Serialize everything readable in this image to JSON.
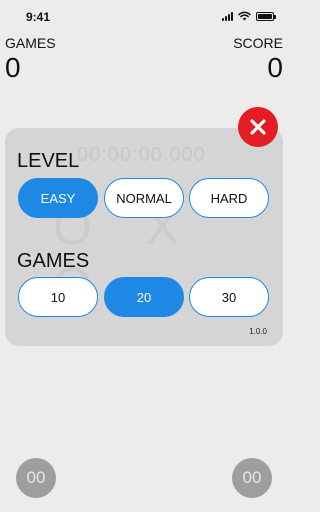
{
  "status": {
    "time": "9:41"
  },
  "header": {
    "games_label": "GAMES",
    "games_value": "0",
    "score_label": "SCORE",
    "score_value": "0"
  },
  "settings": {
    "timer_text": "00:00:00.000",
    "board_ghost": "O X O",
    "level_label": "LEVEL",
    "levels": [
      "EASY",
      "NORMAL",
      "HARD"
    ],
    "selected_level": "EASY",
    "games_label": "GAMES",
    "game_counts": [
      "10",
      "20",
      "30"
    ],
    "selected_games": "20",
    "version": "1.0.0"
  },
  "footer": {
    "left_button": "00",
    "right_button": "00"
  },
  "colors": {
    "accent": "#1e88e5",
    "close": "#e51c23",
    "panel": "#d5d5d5",
    "background": "#ececec"
  }
}
